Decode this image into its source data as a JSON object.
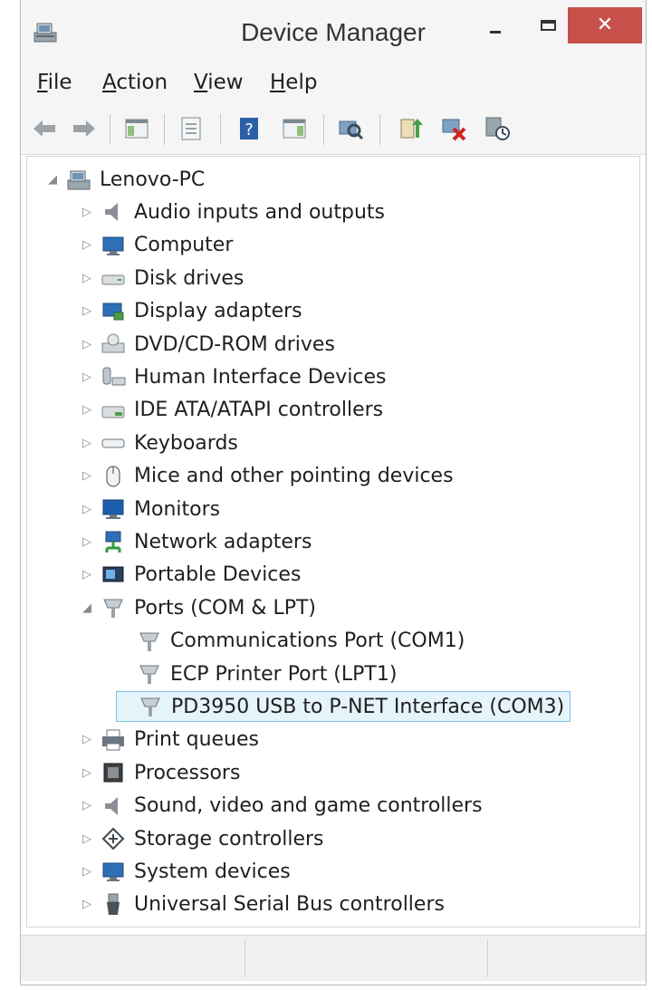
{
  "window": {
    "title": "Device Manager",
    "close_glyph": "✕",
    "accent_close": "#c7514a"
  },
  "menu": {
    "file": {
      "u": "F",
      "rest": "ile"
    },
    "action": {
      "u": "A",
      "rest": "ction"
    },
    "view": {
      "u": "V",
      "rest": "iew"
    },
    "help": {
      "u": "H",
      "rest": "elp"
    }
  },
  "toolbar": {
    "icons": [
      "back-arrow-icon",
      "forward-arrow-icon",
      "show-hide-console-tree-icon",
      "properties-icon",
      "help-icon",
      "show-action-pane-icon",
      "scan-hardware-icon",
      "update-driver-icon",
      "uninstall-device-icon",
      "disable-device-icon"
    ]
  },
  "tree": {
    "root": {
      "label": "Lenovo-PC",
      "expander": "◢"
    },
    "categories": [
      {
        "label": "Audio inputs and outputs",
        "icon": "speaker-icon"
      },
      {
        "label": "Computer",
        "icon": "computer-icon"
      },
      {
        "label": "Disk drives",
        "icon": "disk-drive-icon"
      },
      {
        "label": "Display adapters",
        "icon": "display-adapter-icon"
      },
      {
        "label": "DVD/CD-ROM drives",
        "icon": "dvd-drive-icon"
      },
      {
        "label": "Human Interface Devices",
        "icon": "hid-icon"
      },
      {
        "label": "IDE ATA/ATAPI controllers",
        "icon": "ide-controller-icon"
      },
      {
        "label": "Keyboards",
        "icon": "keyboard-icon"
      },
      {
        "label": "Mice and other pointing devices",
        "icon": "mouse-icon"
      },
      {
        "label": "Monitors",
        "icon": "monitor-icon"
      },
      {
        "label": "Network adapters",
        "icon": "network-adapter-icon"
      },
      {
        "label": "Portable Devices",
        "icon": "portable-device-icon"
      },
      {
        "label": "Ports (COM & LPT)",
        "icon": "port-icon",
        "expanded": true
      },
      {
        "label": "Print queues",
        "icon": "printer-icon"
      },
      {
        "label": "Processors",
        "icon": "processor-icon"
      },
      {
        "label": "Sound, video and game controllers",
        "icon": "sound-icon"
      },
      {
        "label": "Storage controllers",
        "icon": "storage-controller-icon"
      },
      {
        "label": "System devices",
        "icon": "system-device-icon"
      },
      {
        "label": "Universal Serial Bus controllers",
        "icon": "usb-icon"
      }
    ],
    "ports_children": [
      {
        "label": "Communications Port (COM1)"
      },
      {
        "label": "ECP Printer Port (LPT1)"
      },
      {
        "label": "PD3950 USB to P-NET Interface (COM3)",
        "selected": true
      }
    ],
    "collapsed_glyph": "▷",
    "expanded_glyph": "◢"
  }
}
